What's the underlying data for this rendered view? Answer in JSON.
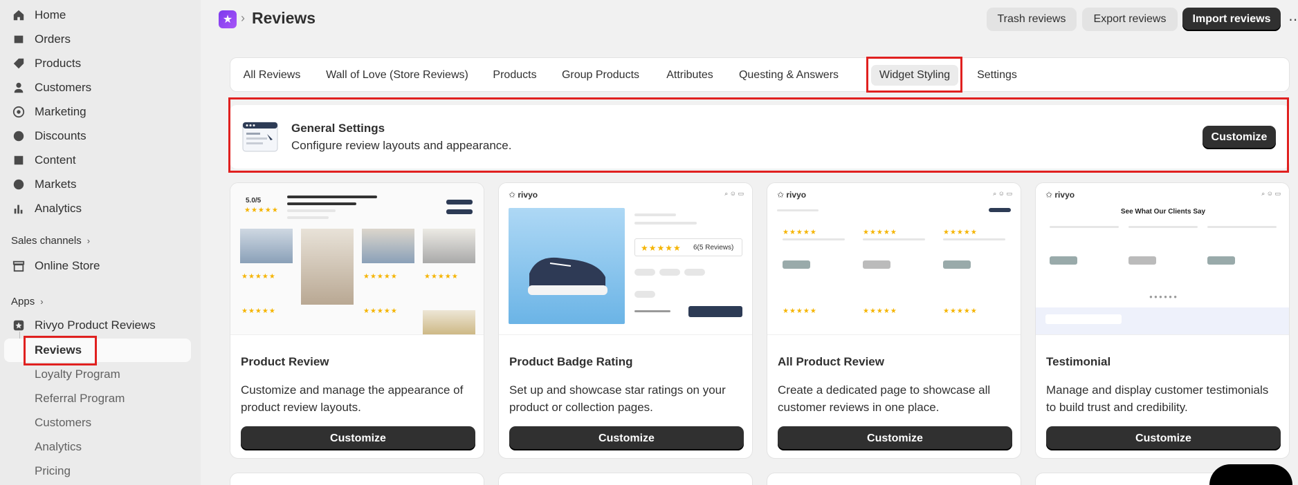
{
  "sidebar": {
    "nav": [
      "Home",
      "Orders",
      "Products",
      "Customers",
      "Marketing",
      "Discounts",
      "Content",
      "Markets",
      "Analytics"
    ],
    "sales_channels_label": "Sales channels",
    "online_store": "Online Store",
    "apps_label": "Apps",
    "app_name": "Rivyo Product Reviews",
    "app_sub": [
      "Reviews",
      "Loyalty Program",
      "Referral Program",
      "Customers",
      "Analytics",
      "Pricing"
    ]
  },
  "header": {
    "title": "Reviews",
    "buttons": [
      "Trash reviews",
      "Export reviews",
      "Import reviews"
    ]
  },
  "tabs": [
    "All Reviews",
    "Wall of Love (Store Reviews)",
    "Products",
    "Group Products",
    "Attributes",
    "Questing & Answers",
    "Widget Styling",
    "Settings"
  ],
  "general": {
    "title": "General Settings",
    "desc": "Configure review layouts and appearance.",
    "button": "Customize"
  },
  "cards": [
    {
      "title": "Product Review",
      "desc": "Customize and manage the appearance of product review layouts.",
      "button": "Customize"
    },
    {
      "title": "Product Badge Rating",
      "desc": "Set up and showcase star ratings on your product or collection pages.",
      "button": "Customize"
    },
    {
      "title": "All Product Review",
      "desc": "Create a dedicated page to showcase all customer reviews in one place.",
      "button": "Customize"
    },
    {
      "title": "Testimonial",
      "desc": "Manage and display customer testimonials to build trust and credibility.",
      "button": "Customize"
    }
  ],
  "previews": {
    "rating": "5.0/5",
    "brand": "rivyo",
    "badge_text": "6(5 Reviews)",
    "testimonial_heading": "See What Our Clients Say"
  },
  "colors": {
    "primary_button": "#303030",
    "highlight": "#e0201f",
    "star": "#f5b400",
    "app_logo": "#7c3aed"
  }
}
